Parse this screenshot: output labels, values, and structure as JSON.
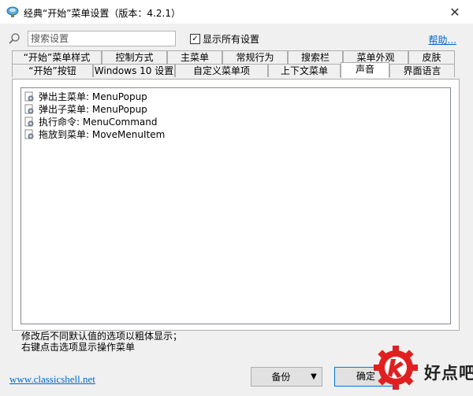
{
  "window": {
    "title": "经典“开始”菜单设置（版本：4.2.1）",
    "close_label": "✕"
  },
  "search": {
    "placeholder": "搜索设置",
    "value": ""
  },
  "show_all": {
    "label": "显示所有设置",
    "checked": true,
    "check_mark": "✓"
  },
  "help": {
    "label": "帮助..."
  },
  "tabs_row1": [
    {
      "label": "“开始”菜单样式"
    },
    {
      "label": "控制方式"
    },
    {
      "label": "主菜单"
    },
    {
      "label": "常规行为"
    },
    {
      "label": "搜索栏"
    },
    {
      "label": "菜单外观"
    },
    {
      "label": "皮肤"
    }
  ],
  "tabs_row2": [
    {
      "label": "“开始”按钮"
    },
    {
      "label": "Windows 10 设置"
    },
    {
      "label": "自定义菜单项"
    },
    {
      "label": "上下文菜单"
    },
    {
      "label": "声音"
    },
    {
      "label": "界面语言"
    }
  ],
  "active_tab": "声音",
  "sound_items": [
    {
      "label": "弹出主菜单: MenuPopup"
    },
    {
      "label": "弹出子菜单: MenuPopup"
    },
    {
      "label": "执行命令: MenuCommand"
    },
    {
      "label": "拖放到菜单: MoveMenuItem"
    }
  ],
  "hint": {
    "line1": "修改后不同默认值的选项以粗体显示；",
    "line2": "右键点击选项显示操作菜单"
  },
  "footer": {
    "link": "www.classicshell.net",
    "backup_label": "备份",
    "ok_label": "确定"
  },
  "watermark": {
    "text": "好点吧"
  },
  "colors": {
    "accent": "#0078d7",
    "link": "#0066cc",
    "watermark": "#e02020"
  }
}
